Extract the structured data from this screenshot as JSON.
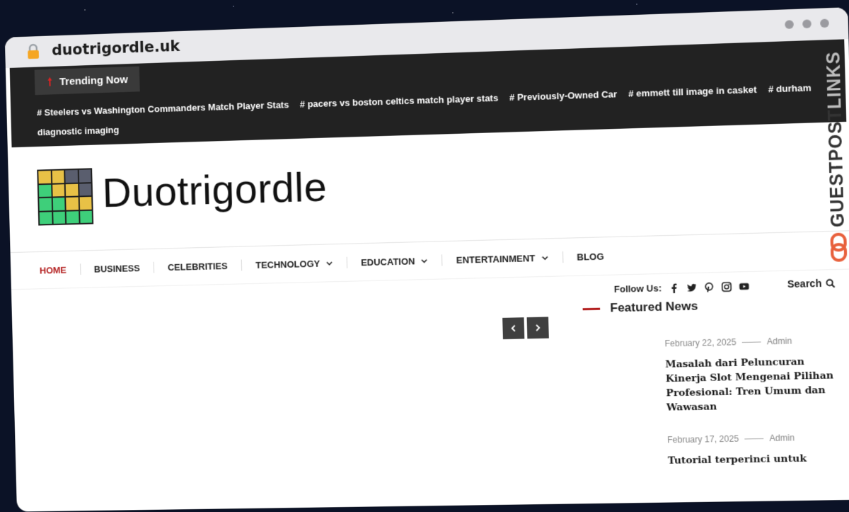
{
  "browser": {
    "url": "duotrigordle.uk"
  },
  "trending": {
    "label": "Trending Now",
    "links": [
      "# Steelers vs Washington Commanders Match Player Stats",
      "# pacers vs boston celtics match player stats",
      "# Previously-Owned Car",
      "# emmett till image in casket",
      "# durham diagnostic imaging"
    ]
  },
  "site": {
    "name": "Duotrigordle",
    "logo_colors": {
      "yellow": "#e8c146",
      "green": "#3ecf7a",
      "gray": "#5a5e6e"
    }
  },
  "nav": {
    "items": [
      {
        "label": "HOME",
        "dropdown": false,
        "active": true
      },
      {
        "label": "BUSINESS",
        "dropdown": false
      },
      {
        "label": "CELEBRITIES",
        "dropdown": false
      },
      {
        "label": "TECHNOLOGY",
        "dropdown": true
      },
      {
        "label": "EDUCATION",
        "dropdown": true
      },
      {
        "label": "ENTERTAINMENT",
        "dropdown": true
      },
      {
        "label": "BLOG",
        "dropdown": false
      }
    ]
  },
  "follow": {
    "label": "Follow Us:",
    "icons": [
      "facebook-icon",
      "twitter-icon",
      "pinterest-icon",
      "instagram-icon",
      "youtube-icon"
    ]
  },
  "search": {
    "label": "Search"
  },
  "featured": {
    "heading": "Featured News",
    "items": [
      {
        "date": "February 22, 2025",
        "author": "Admin",
        "title": "Masalah dari Peluncuran Kinerja Slot Mengenai Pilihan Profesional: Tren Umum dan Wawasan"
      },
      {
        "date": "February 17, 2025",
        "author": "Admin",
        "title": "Tutorial terperinci untuk"
      }
    ]
  },
  "badge": {
    "text_dark": "GUESTPOST",
    "text_light": "LINKS"
  },
  "colors": {
    "accent": "#b11a1a",
    "trending_bg": "#222222",
    "badge_orange": "#e8603c"
  }
}
